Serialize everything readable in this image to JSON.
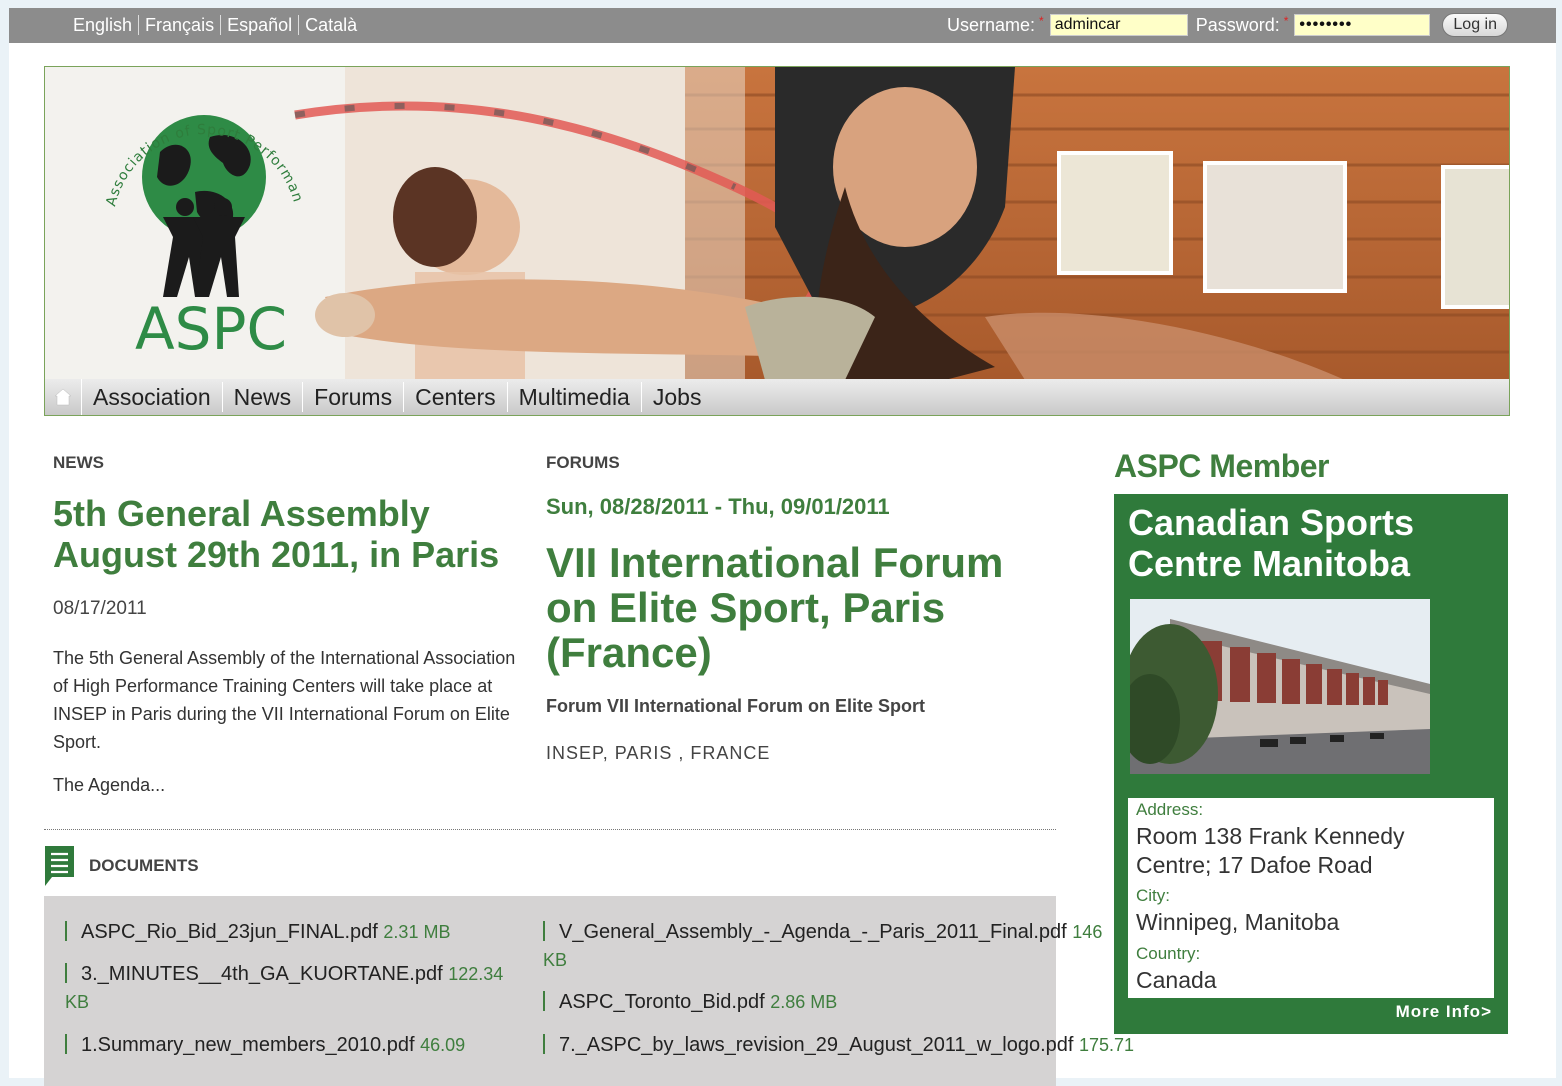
{
  "topbar": {
    "languages": [
      "English",
      "Français",
      "Español",
      "Català"
    ],
    "username_label": "Username:",
    "username_value": "admincar",
    "password_label": "Password:",
    "password_value": "••••••••",
    "login_button": "Log in"
  },
  "banner": {
    "logo_text": "ASPC",
    "logo_ring_text": "Association of Sport Performance Centres"
  },
  "nav": {
    "home_icon": "home-icon",
    "items": [
      "Association",
      "News",
      "Forums",
      "Centers",
      "Multimedia",
      "Jobs"
    ]
  },
  "news": {
    "heading": "NEWS",
    "title": "5th General Assembly August 29th 2011, in Paris",
    "date": "08/17/2011",
    "body": "The 5th General Assembly of the International Association of High Performance Training Centers will take place at INSEP in Paris during the VII International Forum on Elite Sport.",
    "more": "The Agenda..."
  },
  "forums": {
    "heading": "FORUMS",
    "date": "Sun, 08/28/2011 - Thu, 09/01/2011",
    "title": "VII International Forum on Elite Sport, Paris (France)",
    "subtitle": "Forum VII International Forum on Elite Sport",
    "location": "INSEP, PARIS , FRANCE"
  },
  "documents": {
    "heading": "DOCUMENTS",
    "left": [
      {
        "name": "ASPC_Rio_Bid_23jun_FINAL.pdf",
        "size": "2.31 MB"
      },
      {
        "name": "3._MINUTES__4th_GA_KUORTANE.pdf",
        "size": "122.34",
        "size_tail": "KB"
      },
      {
        "name": "1.Summary_new_members_2010.pdf",
        "size": "46.09"
      }
    ],
    "right": [
      {
        "name": "V_General_Assembly_-_Agenda_-_Paris_2011_Final.pdf",
        "size": "146",
        "size_tail": "KB"
      },
      {
        "name": "ASPC_Toronto_Bid.pdf",
        "size": "2.86 MB"
      },
      {
        "name": "7._ASPC_by_laws_revision_29_August_2011_w_logo.pdf",
        "size": "175.71"
      }
    ]
  },
  "member": {
    "heading": "ASPC Member",
    "name": "Canadian Sports Centre Manitoba",
    "address_label": "Address:",
    "address": "Room 138 Frank Kennedy Centre; 17 Dafoe Road",
    "city_label": "City:",
    "city": "Winnipeg, Manitoba",
    "country_label": "Country:",
    "country": "Canada",
    "more_info": "More Info>"
  },
  "colors": {
    "brand_green": "#3f7e3e",
    "member_box_green": "#2f7a3b",
    "topbar_gray": "#8c8c8c",
    "docs_box_gray": "#d5d3d3"
  }
}
